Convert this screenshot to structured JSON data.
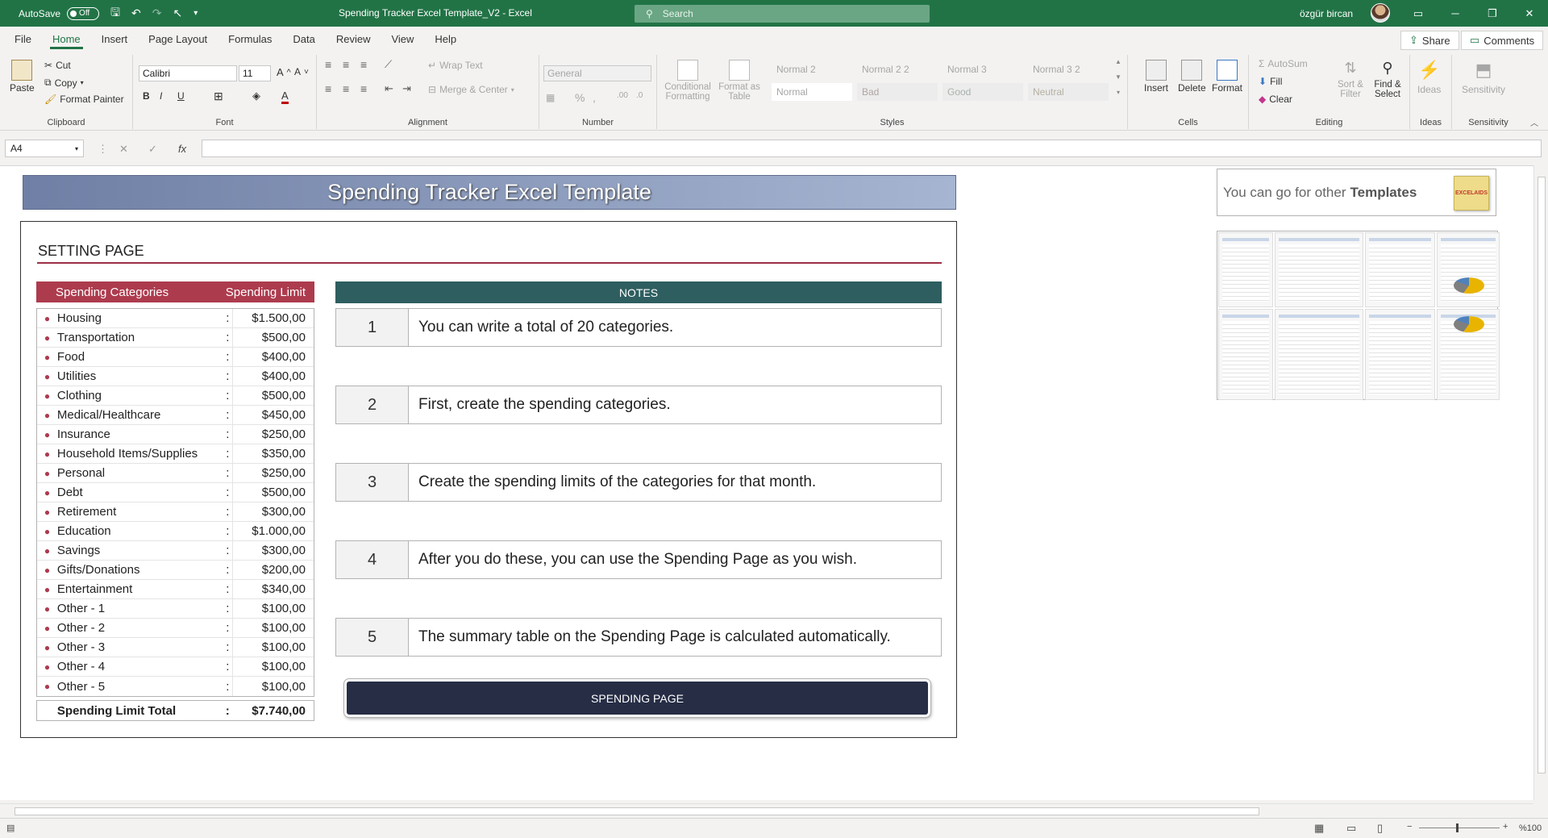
{
  "titlebar": {
    "autosave_label": "AutoSave",
    "autosave_state": "Off",
    "doc_title": "Spending Tracker Excel Template_V2  -  Excel",
    "search_placeholder": "Search",
    "user_name": "özgür bircan"
  },
  "menu": {
    "tabs": [
      "File",
      "Home",
      "Insert",
      "Page Layout",
      "Formulas",
      "Data",
      "Review",
      "View",
      "Help"
    ],
    "active": "Home",
    "share": "Share",
    "comments": "Comments"
  },
  "ribbon": {
    "clipboard": {
      "paste": "Paste",
      "cut": "Cut",
      "copy": "Copy",
      "format_painter": "Format Painter",
      "label": "Clipboard"
    },
    "font": {
      "name": "Calibri",
      "size": "11",
      "label": "Font",
      "bold": "B",
      "italic": "I",
      "underline": "U"
    },
    "alignment": {
      "wrap_text": "Wrap Text",
      "merge_center": "Merge & Center",
      "label": "Alignment"
    },
    "number": {
      "format": "General",
      "label": "Number"
    },
    "styles": {
      "conditional": "Conditional Formatting",
      "format_as_table": "Format as Table",
      "cells": [
        "Normal 2",
        "Normal 2 2",
        "Normal 3",
        "Normal 3 2",
        "Normal",
        "Bad",
        "Good",
        "Neutral"
      ],
      "label": "Styles"
    },
    "cells": {
      "insert": "Insert",
      "delete": "Delete",
      "format": "Format",
      "label": "Cells"
    },
    "editing": {
      "autosum": "AutoSum",
      "fill": "Fill",
      "clear": "Clear",
      "sort_filter": "Sort & Filter",
      "find_select": "Find & Select",
      "label": "Editing"
    },
    "ideas": {
      "ideas": "Ideas",
      "label": "Ideas"
    },
    "sensitivity": {
      "sensitivity": "Sensitivity",
      "label": "Sensitivity"
    }
  },
  "formula_bar": {
    "name_box": "A4",
    "fx": "fx",
    "formula": ""
  },
  "sheet": {
    "banner_title": "Spending Tracker Excel Template",
    "setting_title": "SETTING PAGE",
    "cat_header": "Spending Categories",
    "limit_header": "Spending Limit",
    "categories": [
      {
        "name": "Housing",
        "limit": "$1.500,00"
      },
      {
        "name": "Transportation",
        "limit": "$500,00"
      },
      {
        "name": "Food",
        "limit": "$400,00"
      },
      {
        "name": "Utilities",
        "limit": "$400,00"
      },
      {
        "name": "Clothing",
        "limit": "$500,00"
      },
      {
        "name": "Medical/Healthcare",
        "limit": "$450,00"
      },
      {
        "name": "Insurance",
        "limit": "$250,00"
      },
      {
        "name": "Household Items/Supplies",
        "limit": "$350,00"
      },
      {
        "name": "Personal",
        "limit": "$250,00"
      },
      {
        "name": "Debt",
        "limit": "$500,00"
      },
      {
        "name": "Retirement",
        "limit": "$300,00"
      },
      {
        "name": "Education",
        "limit": "$1.000,00"
      },
      {
        "name": "Savings",
        "limit": "$300,00"
      },
      {
        "name": "Gifts/Donations",
        "limit": "$200,00"
      },
      {
        "name": "Entertainment",
        "limit": "$340,00"
      },
      {
        "name": "Other - 1",
        "limit": "$100,00"
      },
      {
        "name": "Other - 2",
        "limit": "$100,00"
      },
      {
        "name": "Other - 3",
        "limit": "$100,00"
      },
      {
        "name": "Other - 4",
        "limit": "$100,00"
      },
      {
        "name": "Other - 5",
        "limit": "$100,00"
      }
    ],
    "total_label": "Spending Limit Total",
    "total_value": "$7.740,00",
    "notes_header": "NOTES",
    "notes": [
      {
        "num": "1",
        "text": "You can write a total of 20 categories."
      },
      {
        "num": "2",
        "text": "First, create the spending categories."
      },
      {
        "num": "3",
        "text": "Create the spending limits of the categories for that month."
      },
      {
        "num": "4",
        "text": "After you do these, you can use the Spending Page as you wish."
      },
      {
        "num": "5",
        "text": "The summary table on the Spending Page is calculated automatically."
      }
    ],
    "spending_button": "SPENDING PAGE",
    "promo_text": "You can go for other",
    "promo_bold": "Templates",
    "promo_logo": "EXCELAIDS"
  },
  "status": {
    "zoom": "%100"
  },
  "colors": {
    "excel_green": "#217346",
    "category_header": "#ad3b4e",
    "notes_header": "#2e5e60",
    "button": "#262d45"
  }
}
